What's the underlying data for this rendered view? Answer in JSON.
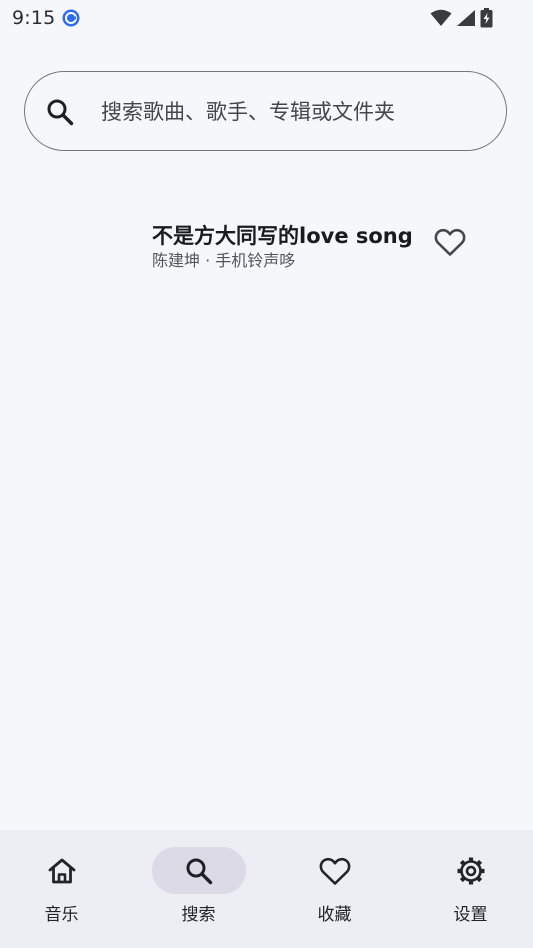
{
  "status_bar": {
    "time": "9:15",
    "app_icon": "blue-circle-app-icon",
    "icons": [
      "wifi-icon",
      "cellular-signal-icon",
      "battery-charging-icon"
    ]
  },
  "search": {
    "icon": "search-icon",
    "placeholder": "搜索歌曲、歌手、专辑或文件夹"
  },
  "results": [
    {
      "title": "不是方大同写的love song",
      "artist": "陈建坤",
      "separator": " · ",
      "album": "手机铃声哆",
      "favorite_icon": "heart-outline-icon"
    }
  ],
  "bottom_nav": {
    "items": [
      {
        "label": "音乐",
        "icon": "home-icon",
        "active": false
      },
      {
        "label": "搜索",
        "icon": "search-icon",
        "active": true
      },
      {
        "label": "收藏",
        "icon": "heart-outline-icon",
        "active": false
      },
      {
        "label": "设置",
        "icon": "gear-icon",
        "active": false
      }
    ]
  },
  "colors": {
    "background": "#f6f7fb",
    "nav_background": "#eceef4",
    "active_pill": "#dcdae7",
    "outline": "#75767c",
    "app_icon_blue": "#2f6bf2"
  }
}
